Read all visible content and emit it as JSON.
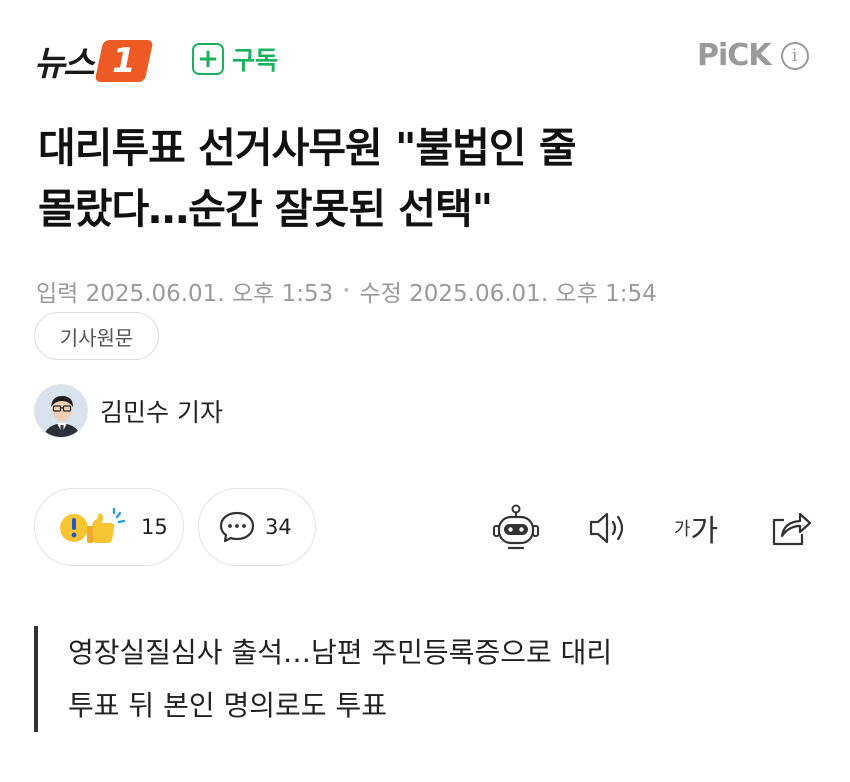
{
  "header": {
    "logo_text": "뉴스",
    "logo_badge": "1",
    "subscribe_icon": "+",
    "subscribe_label": "구독",
    "pick_label": "PiCK",
    "info_icon": "i"
  },
  "article": {
    "headline_line1": "대리투표 선거사무원 \"불법인 줄",
    "headline_line2": "몰랐다…순간 잘못된 선택\"",
    "input_date": "입력 2025.06.01. 오후 1:53",
    "dot": "•",
    "edit_date": "수정 2025.06.01. 오후 1:54",
    "original_button": "기사원문",
    "reporter": "김민수 기자",
    "reaction_count": "15",
    "comment_count": "34",
    "font_size_small": "가",
    "font_size_large": "가",
    "quote_line1": "영장실질심사 출석…남편 주민등록증으로 대리",
    "quote_line2": "투표 뒤 본인 명의로도 투표"
  },
  "icons": [
    "plus-icon",
    "info-icon",
    "reaction-emoji-icon",
    "comment-icon",
    "robot-summary-icon",
    "speaker-icon",
    "font-size-icon",
    "share-icon"
  ],
  "colors": {
    "brand_orange": "#ee5a24",
    "subscribe_green": "#19b35d",
    "muted": "#9a9a9a"
  }
}
